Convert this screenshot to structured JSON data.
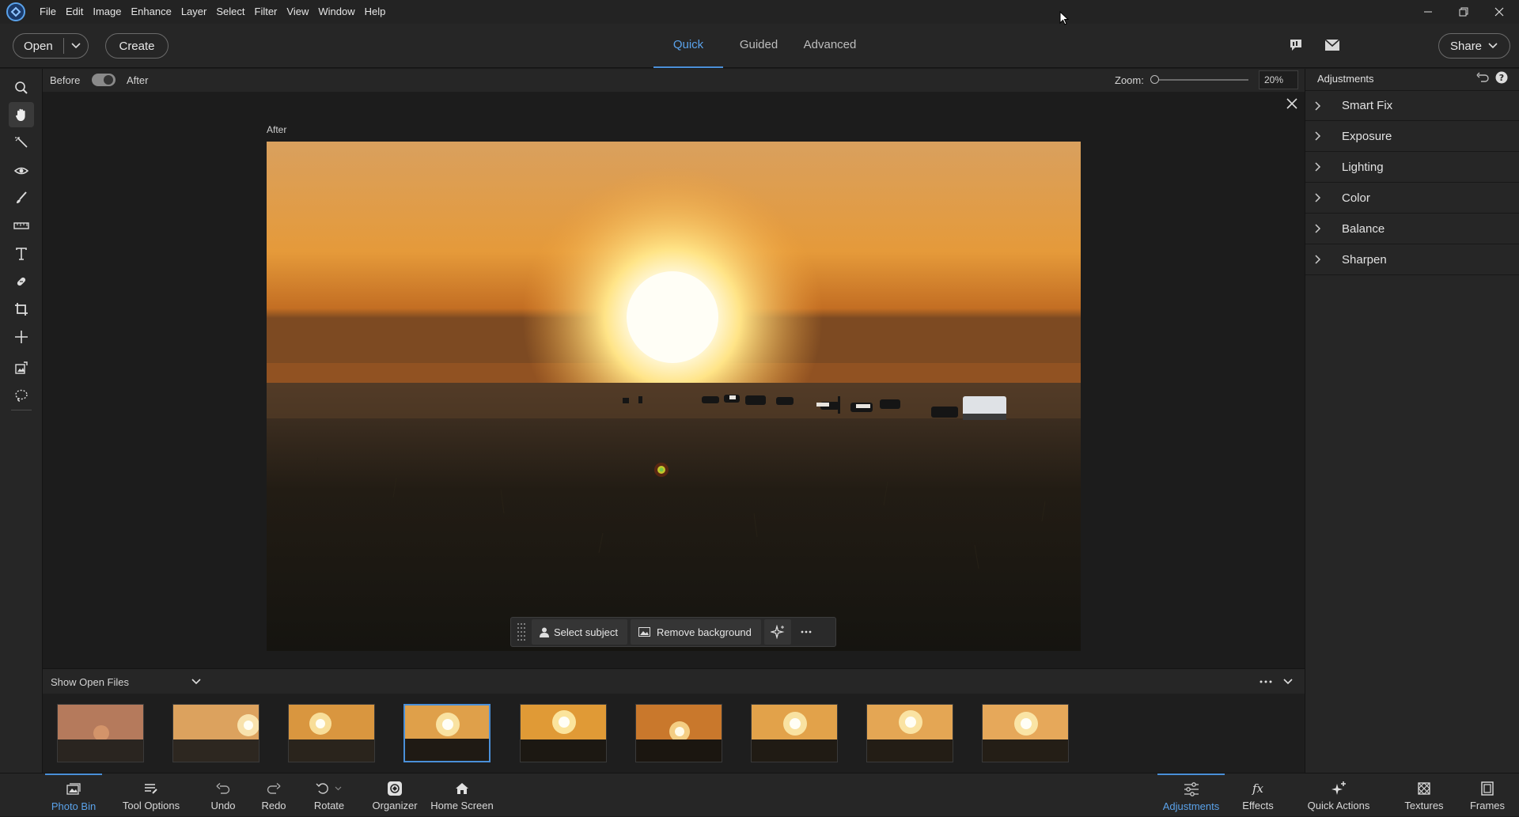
{
  "menubar": {
    "items": [
      "File",
      "Edit",
      "Image",
      "Enhance",
      "Layer",
      "Select",
      "Filter",
      "View",
      "Window",
      "Help"
    ]
  },
  "topbar": {
    "open_label": "Open",
    "create_label": "Create",
    "modes": [
      {
        "label": "Quick",
        "active": true
      },
      {
        "label": "Guided",
        "active": false
      },
      {
        "label": "Advanced",
        "active": false
      }
    ],
    "share_label": "Share"
  },
  "viewbar": {
    "before_label": "Before",
    "after_label": "After",
    "zoom_label": "Zoom:",
    "zoom_value": "20%"
  },
  "canvas": {
    "image_caption": "After"
  },
  "float_bar": {
    "select_subject": "Select subject",
    "remove_background": "Remove background"
  },
  "adjustments": {
    "title": "Adjustments",
    "sections": [
      "Smart Fix",
      "Exposure",
      "Lighting",
      "Color",
      "Balance",
      "Sharpen"
    ]
  },
  "bin": {
    "dropdown_value": "Show Open Files",
    "thumbnail_count": 9,
    "selected_index": 3
  },
  "bottombar": {
    "left": [
      "Photo Bin",
      "Tool Options",
      "Undo",
      "Redo",
      "Rotate",
      "Organizer",
      "Home Screen"
    ],
    "right": [
      "Adjustments",
      "Effects",
      "Quick Actions",
      "Textures",
      "Frames"
    ],
    "active_left": "Photo Bin",
    "active_right": "Adjustments"
  },
  "colors": {
    "accent": "#4a8fd8",
    "sky_top": "#d9a05e",
    "sun": "#fffbe8"
  },
  "icons": {
    "tools": [
      "zoom-icon",
      "hand-icon",
      "quick-selection-icon",
      "red-eye-icon",
      "whiten-teeth-icon",
      "straighten-icon",
      "type-icon",
      "spot-healing-icon",
      "crop-icon",
      "move-icon",
      "content-aware-move-icon",
      "lasso-icon"
    ]
  }
}
